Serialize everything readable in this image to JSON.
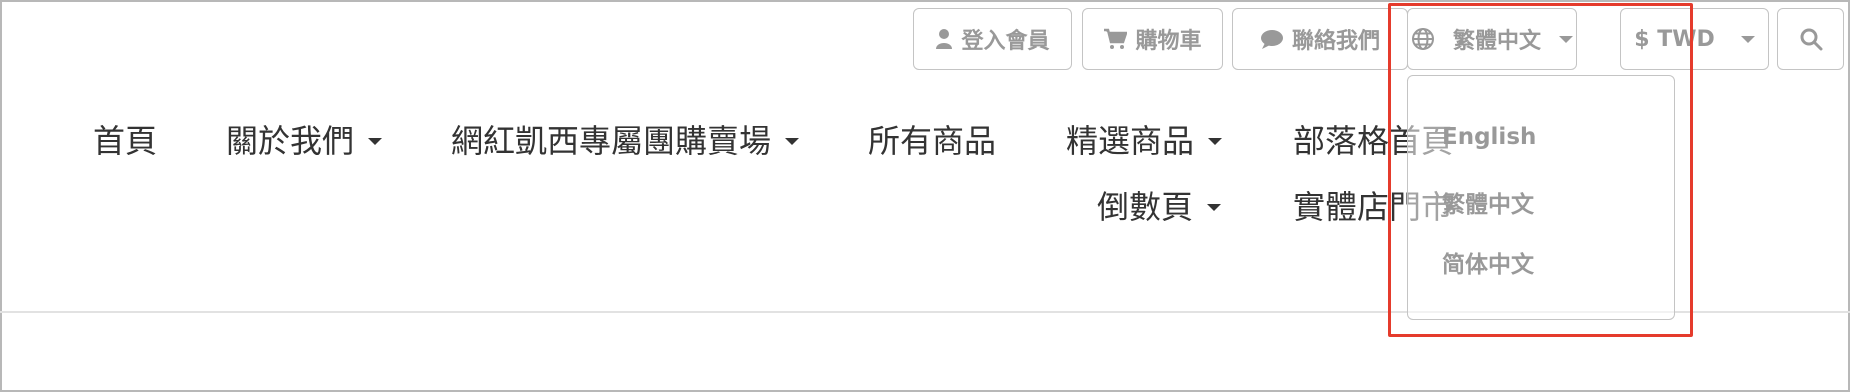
{
  "top_bar": {
    "login_label": "登入會員",
    "cart_label": "購物車",
    "contact_label": "聯絡我們",
    "language_label": "繁體中文",
    "currency_label": "$ TWD"
  },
  "icons": {
    "login": "user-icon",
    "cart": "cart-icon",
    "contact": "chat-bubble-icon",
    "language": "globe-icon",
    "search": "search-icon"
  },
  "nav": {
    "items": [
      {
        "label": "首頁"
      },
      {
        "label": "關於我們"
      },
      {
        "label": "網紅凱西專屬團購賣場"
      },
      {
        "label": "所有商品"
      },
      {
        "label": "精選商品"
      },
      {
        "label": "部落格首頁"
      },
      {
        "label": "倒數頁"
      },
      {
        "label": "實體店門市"
      }
    ]
  },
  "language_dropdown": {
    "options": [
      {
        "label": "English"
      },
      {
        "label": "繁體中文"
      },
      {
        "label": "简体中文"
      }
    ]
  },
  "colors": {
    "highlight": "#e53b2c",
    "muted_text": "#999999",
    "nav_text": "#333333",
    "border": "#c4c4c4"
  }
}
